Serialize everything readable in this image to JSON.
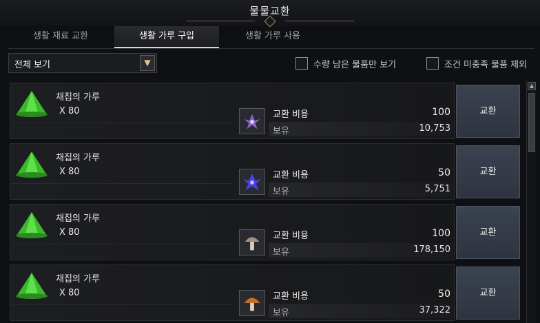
{
  "window": {
    "title": "물물교환"
  },
  "tabs": [
    {
      "label": "생활 재료 교환",
      "active": false
    },
    {
      "label": "생활 가루 구입",
      "active": true
    },
    {
      "label": "생활 가루 사용",
      "active": false
    }
  ],
  "filter": {
    "dropdown_value": "전체 보기",
    "check_remaining_label": "수량 남은 물품만 보기",
    "check_exclude_label": "조건 미충족 물품 제외"
  },
  "list": {
    "items": [
      {
        "name": "채집의 가루",
        "qty": "X 80",
        "material_icon": "purple-flower-icon",
        "cost_label": "교환 비용",
        "cost": "100",
        "owned_label": "보유",
        "owned": "10,753",
        "button": "교환"
      },
      {
        "name": "채집의 가루",
        "qty": "X 80",
        "material_icon": "blue-flower-icon",
        "cost_label": "교환 비용",
        "cost": "50",
        "owned_label": "보유",
        "owned": "5,751",
        "button": "교환"
      },
      {
        "name": "채집의 가루",
        "qty": "X 80",
        "material_icon": "gray-mushroom-icon",
        "cost_label": "교환 비용",
        "cost": "100",
        "owned_label": "보유",
        "owned": "178,150",
        "button": "교환"
      },
      {
        "name": "채집의 가루",
        "qty": "X 80",
        "material_icon": "brown-mushroom-icon",
        "cost_label": "교환 비용",
        "cost": "50",
        "owned_label": "보유",
        "owned": "37,322",
        "button": "교환"
      }
    ]
  },
  "colors": {
    "accent": "#d9d6cc",
    "button": "#343b47",
    "powder": "#4cd13a"
  }
}
